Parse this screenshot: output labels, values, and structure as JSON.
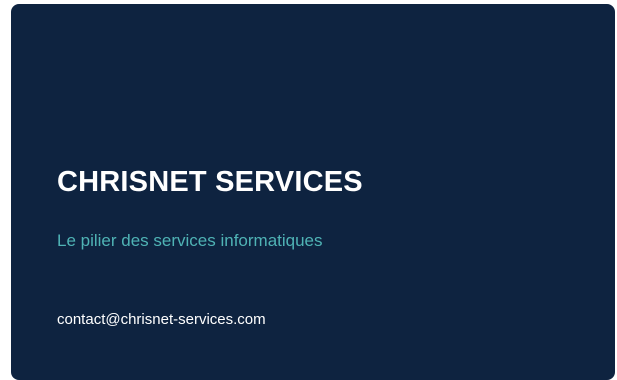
{
  "card": {
    "company_name": "CHRISNET SERVICES",
    "tagline": "Le pilier des services informatiques",
    "email": "contact@chrisnet-services.com"
  },
  "colors": {
    "card_background": "#0e2340",
    "tagline": "#4fb3b5",
    "text": "#ffffff"
  }
}
